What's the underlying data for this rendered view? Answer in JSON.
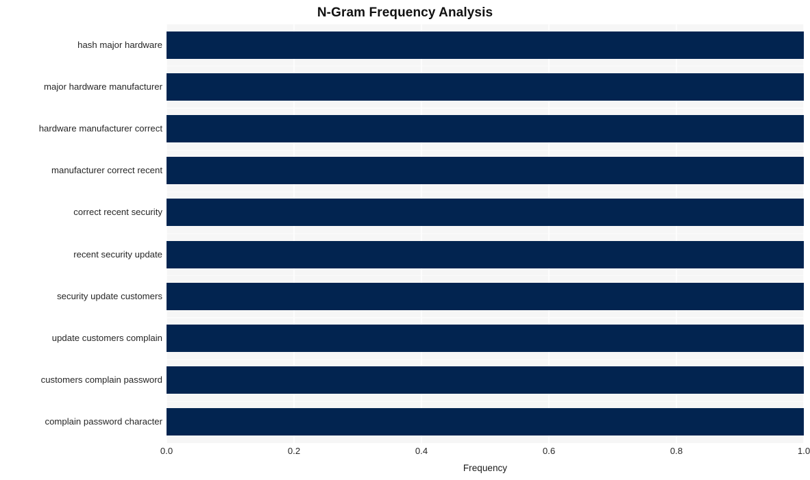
{
  "chart_data": {
    "type": "bar",
    "orientation": "horizontal",
    "title": "N-Gram Frequency Analysis",
    "xlabel": "Frequency",
    "ylabel": "",
    "categories": [
      "hash major hardware",
      "major hardware manufacturer",
      "hardware manufacturer correct",
      "manufacturer correct recent",
      "correct recent security",
      "recent security update",
      "security update customers",
      "update customers complain",
      "customers complain password",
      "complain password character"
    ],
    "values": [
      1.0,
      1.0,
      1.0,
      1.0,
      1.0,
      1.0,
      1.0,
      1.0,
      1.0,
      1.0
    ],
    "xlim": [
      0.0,
      1.0
    ],
    "xticks": [
      0.0,
      0.2,
      0.4,
      0.6,
      0.8,
      1.0
    ],
    "xtick_labels": [
      "0.0",
      "0.2",
      "0.4",
      "0.6",
      "0.8",
      "1.0"
    ],
    "grid": true,
    "legend": false,
    "bar_color": "#022450",
    "plot_background": "#f6f6f6",
    "figure_background": "#ffffff",
    "title_color": "#111111",
    "tick_label_color": "#262626"
  }
}
